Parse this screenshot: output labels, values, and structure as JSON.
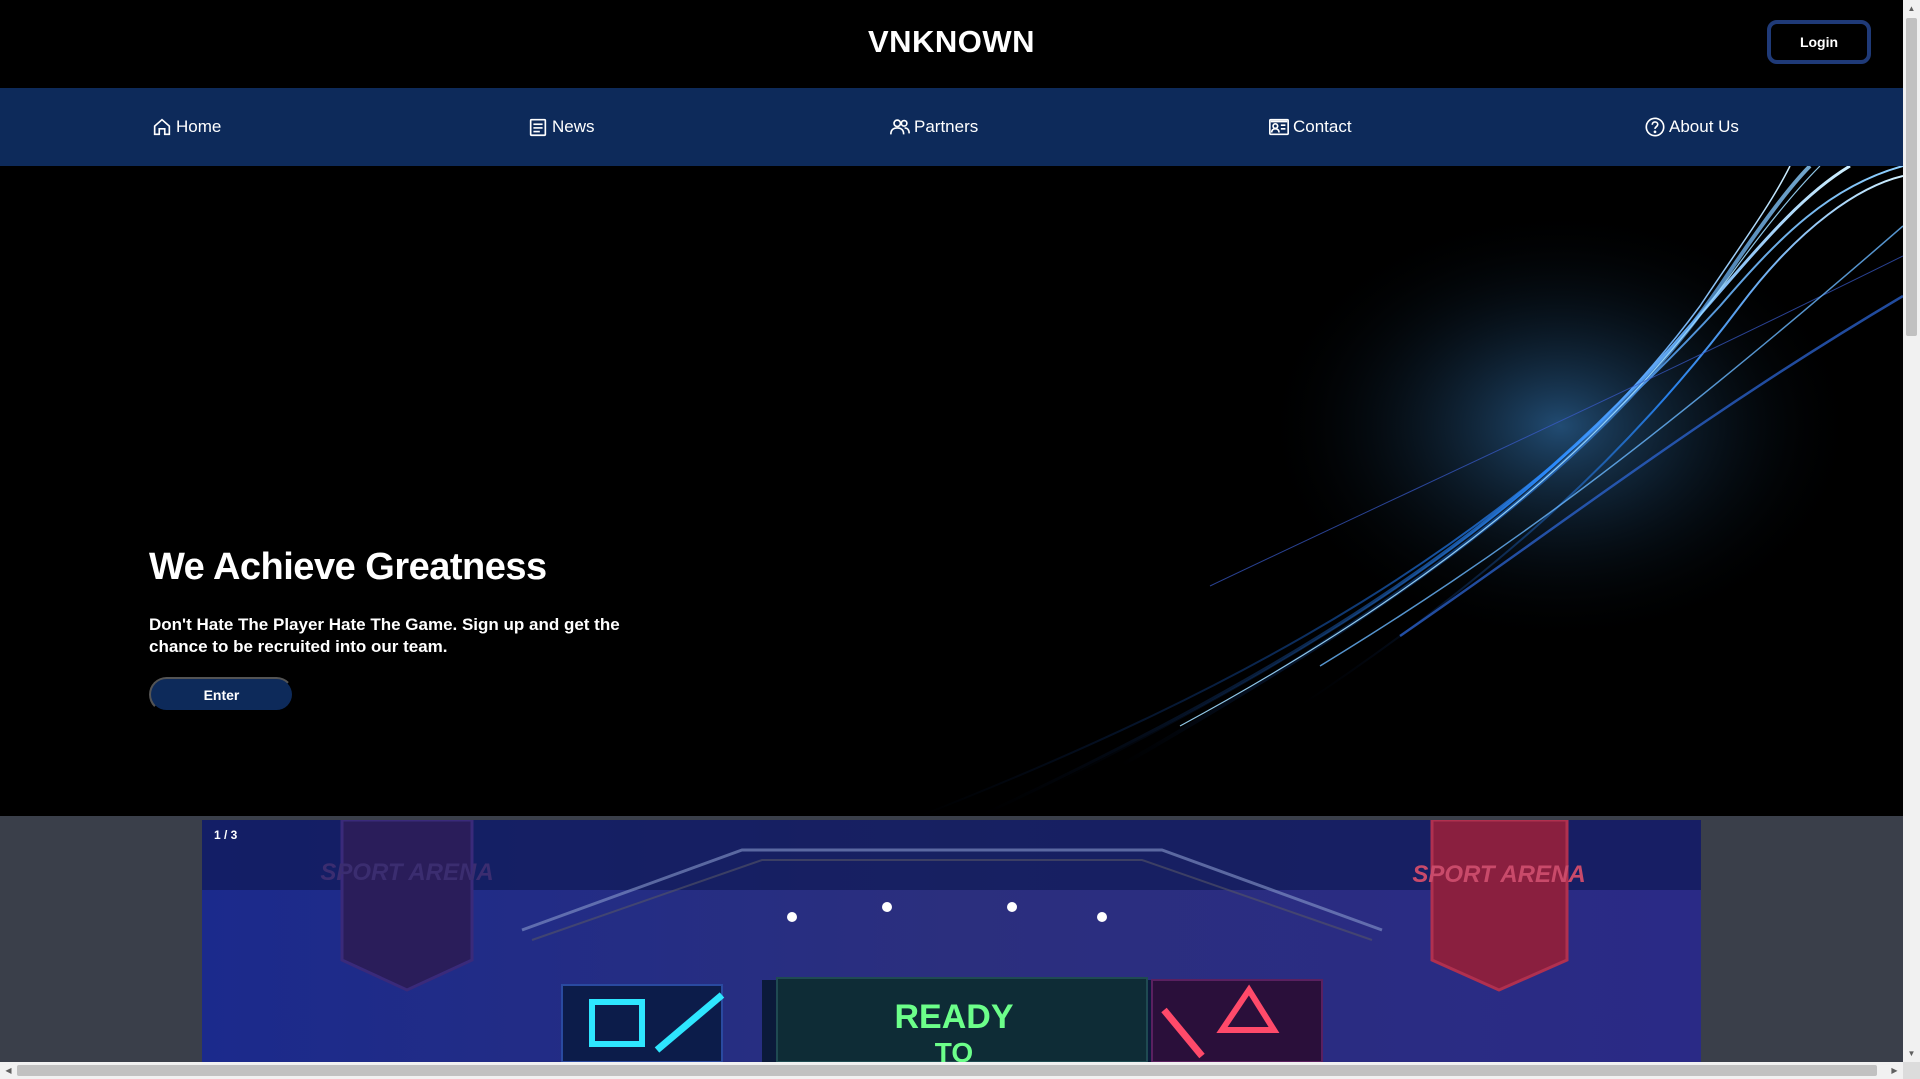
{
  "header": {
    "brand": "VNKNOWN",
    "login_label": "Login"
  },
  "nav": {
    "items": [
      {
        "label": "Home",
        "icon": "home-icon"
      },
      {
        "label": "News",
        "icon": "newspaper-icon"
      },
      {
        "label": "Partners",
        "icon": "users-icon"
      },
      {
        "label": "Contact",
        "icon": "contact-card-icon"
      },
      {
        "label": "About Us",
        "icon": "question-circle-icon"
      }
    ]
  },
  "hero": {
    "title": "We Achieve Greatness",
    "subtitle": "Don't Hate The Player Hate The Game. Sign up and get the chance to be recruited into our team.",
    "cta_label": "Enter"
  },
  "slideshow": {
    "counter": "1 / 3",
    "banner_left": "SPORT ARENA",
    "banner_right": "SPORT ARENA",
    "screen_text_line1": "READY",
    "screen_text_line2": "TO"
  },
  "colors": {
    "nav_bg": "#0d2a5a",
    "accent": "#1f3a78",
    "page_bg": "#000000"
  }
}
